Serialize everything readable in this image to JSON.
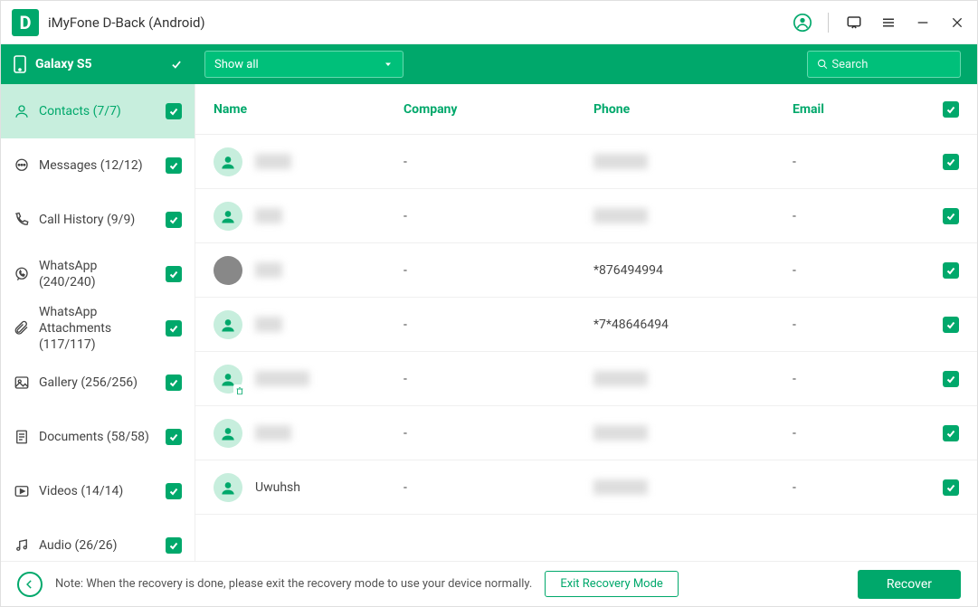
{
  "titlebar": {
    "app_name": "iMyFone D-Back (Android)"
  },
  "greenbar": {
    "device": "Galaxy S5",
    "filter": "Show all",
    "search_placeholder": "Search"
  },
  "sidebar": {
    "items": [
      {
        "label": "Contacts (7/7)",
        "icon": "person",
        "active": true
      },
      {
        "label": "Messages (12/12)",
        "icon": "message",
        "active": false
      },
      {
        "label": "Call History (9/9)",
        "icon": "phone",
        "active": false
      },
      {
        "label": "WhatsApp (240/240)",
        "icon": "whatsapp",
        "active": false
      },
      {
        "label": "WhatsApp Attachments (117/117)",
        "icon": "attach",
        "active": false
      },
      {
        "label": "Gallery (256/256)",
        "icon": "gallery",
        "active": false
      },
      {
        "label": "Documents (58/58)",
        "icon": "document",
        "active": false
      },
      {
        "label": "Videos (14/14)",
        "icon": "video",
        "active": false
      },
      {
        "label": "Audio (26/26)",
        "icon": "audio",
        "active": false
      }
    ]
  },
  "table": {
    "headers": {
      "name": "Name",
      "company": "Company",
      "phone": "Phone",
      "email": "Email"
    },
    "rows": [
      {
        "name": "████",
        "company": "-",
        "phone": "██████",
        "email": "-",
        "blurred": true,
        "photo": false,
        "deleted": false
      },
      {
        "name": "███",
        "company": "-",
        "phone": "██████",
        "email": "-",
        "blurred": true,
        "photo": false,
        "deleted": false
      },
      {
        "name": "███",
        "company": "-",
        "phone": "*876494994",
        "email": "-",
        "blurred": true,
        "photo": true,
        "deleted": false,
        "phone_blur": false
      },
      {
        "name": "███",
        "company": "-",
        "phone": "*7*48646494",
        "email": "-",
        "blurred": true,
        "photo": false,
        "deleted": false,
        "phone_blur": false
      },
      {
        "name": "██████",
        "company": "-",
        "phone": "██████",
        "email": "-",
        "blurred": true,
        "photo": false,
        "deleted": true
      },
      {
        "name": "████",
        "company": "-",
        "phone": "██████",
        "email": "-",
        "blurred": true,
        "photo": false,
        "deleted": false
      },
      {
        "name": "Uwuhsh",
        "company": "-",
        "phone": "██████",
        "email": "-",
        "blurred": false,
        "photo": false,
        "deleted": false,
        "phone_blur": true
      }
    ]
  },
  "footer": {
    "note": "Note: When the recovery is done, please exit the recovery mode to use your device normally.",
    "exit": "Exit Recovery Mode",
    "recover": "Recover"
  }
}
